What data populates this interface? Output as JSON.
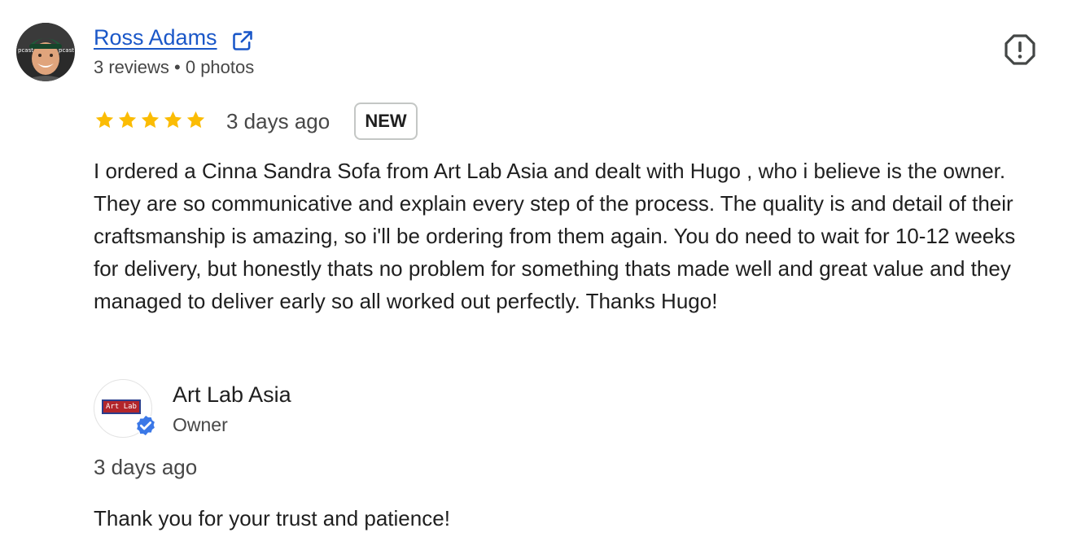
{
  "review": {
    "reviewer": {
      "name": "Ross Adams",
      "meta": "3 reviews • 0 photos",
      "avatar_icon": "reviewer-photo"
    },
    "rating": 5,
    "rating_max": 5,
    "date": "3 days ago",
    "badge": "NEW",
    "text": "I ordered a Cinna Sandra Sofa from Art Lab Asia and dealt with Hugo , who i believe is the owner. They are so communicative and explain every step of the process. The quality is and detail of their craftsmanship is amazing, so i'll be ordering from them again. You do need to wait for 10-12 weeks for delivery, but honestly thats no problem for something thats made well and great value and they managed to deliver early so all worked out perfectly. Thanks Hugo!"
  },
  "owner_reply": {
    "name": "Art Lab Asia",
    "role": "Owner",
    "logo_text": "Art Lab",
    "date": "3 days ago",
    "text": "Thank you for your trust and patience!"
  },
  "colors": {
    "link": "#1a57c8",
    "star": "#fbbc04",
    "verified": "#3b78e7",
    "text": "#1f1f1f",
    "muted": "#474747"
  },
  "icons": [
    "external-link-icon",
    "report-icon",
    "star-icon",
    "verified-badge-icon"
  ]
}
